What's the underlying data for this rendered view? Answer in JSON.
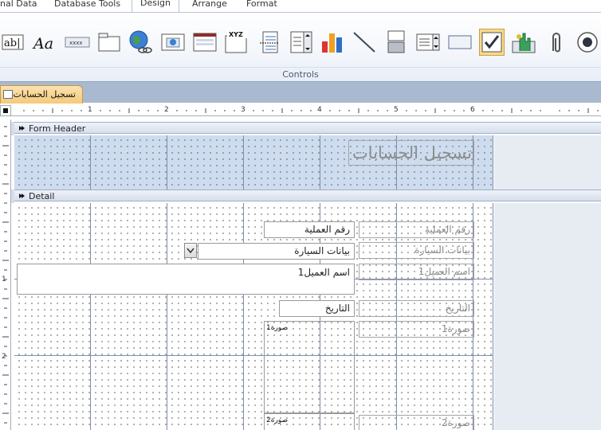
{
  "ribbon": {
    "tabs": [
      {
        "label": "nal Data",
        "active": false
      },
      {
        "label": "Database Tools",
        "active": false
      },
      {
        "label": "Design",
        "active": true
      },
      {
        "label": "Arrange",
        "active": false
      },
      {
        "label": "Format",
        "active": false
      }
    ],
    "controls": [
      {
        "icon": "text-box-icon",
        "glyph": "ab|"
      },
      {
        "icon": "label-icon",
        "glyph": "Aa"
      },
      {
        "icon": "button-icon",
        "glyph": "xxxx"
      },
      {
        "icon": "tab-control-icon",
        "glyph": ""
      },
      {
        "icon": "hyperlink-icon",
        "glyph": ""
      },
      {
        "icon": "web-browser-icon",
        "glyph": ""
      },
      {
        "icon": "navigation-control-icon",
        "glyph": ""
      },
      {
        "icon": "option-group-icon",
        "glyph": "XYZ"
      },
      {
        "icon": "page-break-icon",
        "glyph": ""
      },
      {
        "icon": "combo-box-icon",
        "glyph": ""
      },
      {
        "icon": "chart-icon",
        "glyph": ""
      },
      {
        "icon": "line-icon",
        "glyph": ""
      },
      {
        "icon": "toggle-button-icon",
        "glyph": ""
      },
      {
        "icon": "list-box-icon",
        "glyph": ""
      },
      {
        "icon": "rectangle-icon",
        "glyph": ""
      },
      {
        "icon": "check-box-icon",
        "glyph": ""
      },
      {
        "icon": "unbound-object-frame-icon",
        "glyph": ""
      },
      {
        "icon": "attachment-icon",
        "glyph": ""
      },
      {
        "icon": "option-button-icon",
        "glyph": ""
      }
    ],
    "group_label": "Controls"
  },
  "document": {
    "tab_label": "تسجيل الحسابات"
  },
  "ruler": {
    "h_numbers": [
      "1",
      "2",
      "3",
      "4",
      "5",
      "6"
    ],
    "v_numbers": [
      "1",
      "2"
    ]
  },
  "sections": {
    "header_label": "Form Header",
    "detail_label": "Detail"
  },
  "form": {
    "title": "تسجيل الحسابات",
    "fields": {
      "transaction_no": {
        "label": "رقم العملية",
        "value": "رقم العملية"
      },
      "car_data": {
        "label": "بيانات السيارة",
        "value": "بيانات السيارة"
      },
      "customer_name": {
        "label": "اسم العميل1",
        "value": "اسم العميل1"
      },
      "date": {
        "label": "التاريخ",
        "value": "التاريخ"
      },
      "image1": {
        "label": "صورة1",
        "frame_label": "صورة1"
      },
      "image2": {
        "label": "صورة2",
        "frame_label": "صورة2"
      }
    }
  },
  "colors": {
    "header_section_fill": "#cddcee",
    "selected_control": "#f9d98d",
    "document_tab": "#f5c979"
  }
}
